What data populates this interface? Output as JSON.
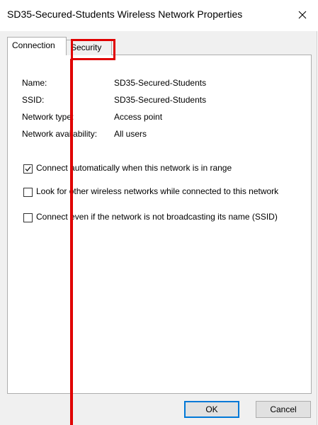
{
  "window": {
    "title": "SD35-Secured-Students Wireless Network Properties"
  },
  "tabs": [
    {
      "label": "Connection",
      "active": true
    },
    {
      "label": "Security",
      "active": false
    }
  ],
  "properties": [
    {
      "label": "Name:",
      "value": "SD35-Secured-Students"
    },
    {
      "label": "SSID:",
      "value": "SD35-Secured-Students"
    },
    {
      "label": "Network type:",
      "value": "Access point"
    },
    {
      "label": "Network availability:",
      "value": "All users"
    }
  ],
  "options": [
    {
      "label": "Connect automatically when this network is in range",
      "checked": true
    },
    {
      "label": "Look for other wireless networks while connected to this network",
      "checked": false
    },
    {
      "label": "Connect even if the network is not broadcasting its name (SSID)",
      "checked": false
    }
  ],
  "buttons": {
    "ok": "OK",
    "cancel": "Cancel"
  },
  "annotation": {
    "color": "#e00000"
  },
  "colors": {
    "accent": "#0078d7"
  }
}
